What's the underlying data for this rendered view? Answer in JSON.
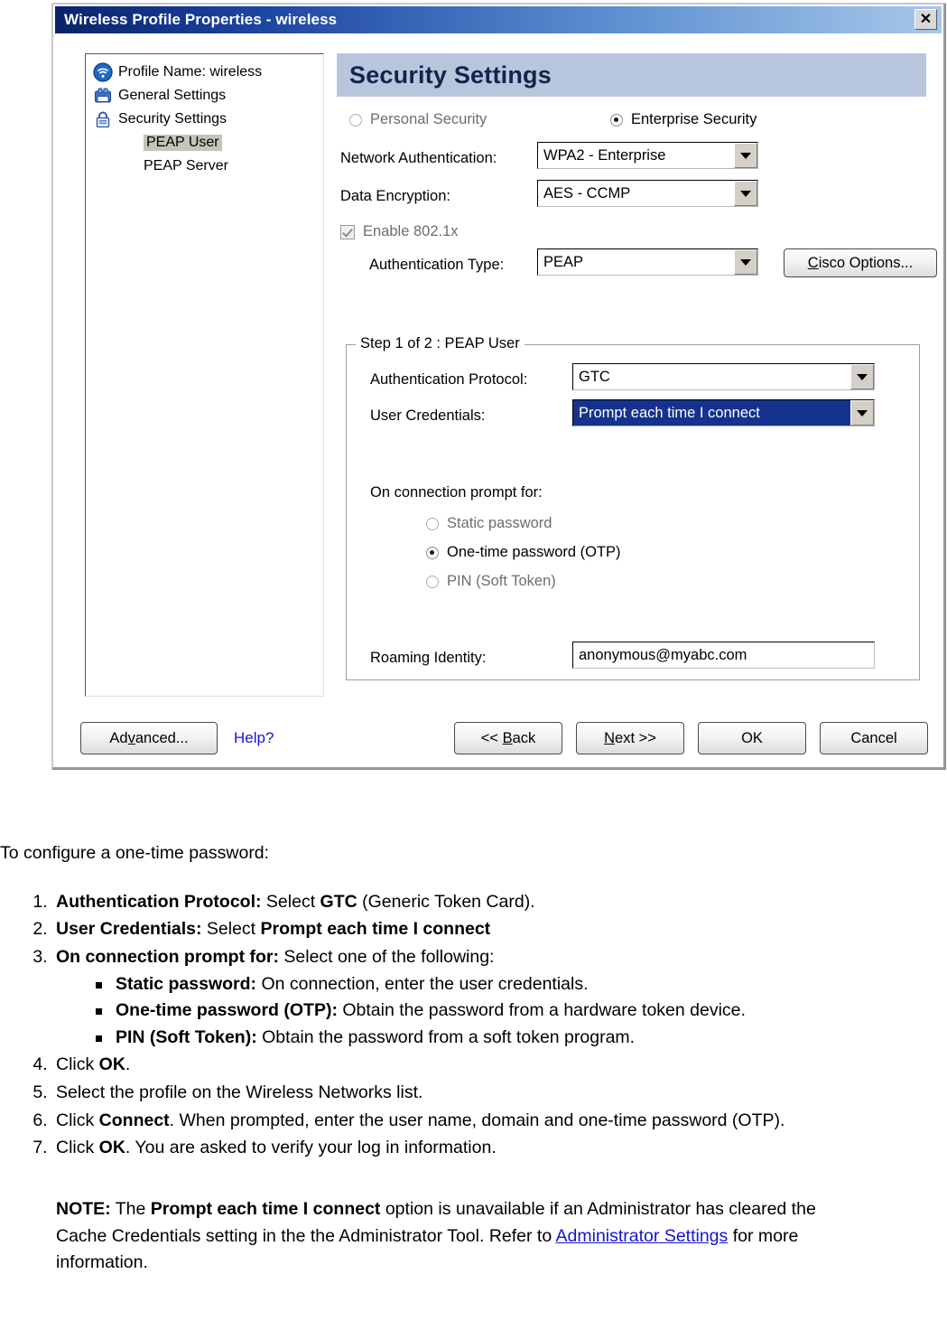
{
  "dialog": {
    "title": "Wireless Profile Properties - wireless",
    "close_label": "✕",
    "pane_title": "Security Settings",
    "tree": {
      "items": [
        {
          "label": "Profile Name: wireless",
          "icon": "wireless-globe-icon",
          "level": 0,
          "selected": false
        },
        {
          "label": "General Settings",
          "icon": "floppy-disk-icon",
          "level": 0,
          "selected": false
        },
        {
          "label": "Security Settings",
          "icon": "padlock-icon",
          "level": 0,
          "selected": false
        },
        {
          "label": "PEAP User",
          "icon": "",
          "level": 1,
          "selected": true
        },
        {
          "label": "PEAP Server",
          "icon": "",
          "level": 1,
          "selected": false
        }
      ]
    },
    "security_mode": {
      "personal_label": "Personal Security",
      "personal_selected": false,
      "enterprise_label": "Enterprise Security",
      "enterprise_selected": true
    },
    "fields": {
      "network_auth_label": "Network Authentication:",
      "network_auth_value": "WPA2 - Enterprise",
      "data_encryption_label": "Data Encryption:",
      "data_encryption_value": "AES - CCMP",
      "enable_8021x_label": "Enable 802.1x",
      "enable_8021x_checked": true,
      "enable_8021x_disabled": true,
      "auth_type_label": "Authentication Type:",
      "auth_type_value": "PEAP",
      "cisco_options_label": "Cisco Options..."
    },
    "step_group": {
      "title": "Step 1 of 2 : PEAP User",
      "auth_protocol_label": "Authentication Protocol:",
      "auth_protocol_value": "GTC",
      "user_credentials_label": "User Credentials:",
      "user_credentials_value": "Prompt each time I connect",
      "prompt_for_label": "On connection prompt for:",
      "prompt_options": [
        {
          "label": "Static password",
          "selected": false
        },
        {
          "label": "One-time password (OTP)",
          "selected": true
        },
        {
          "label": "PIN (Soft Token)",
          "selected": false
        }
      ],
      "roaming_identity_label": "Roaming Identity:",
      "roaming_identity_value": "anonymous@myabc.com"
    },
    "footer": {
      "advanced_label": "Advanced...",
      "advanced_mnemonic": "v",
      "help_label": "Help?",
      "back_label": "<< Back",
      "back_mnemonic": "B",
      "next_label": "Next >>",
      "next_mnemonic": "N",
      "ok_label": "OK",
      "cancel_label": "Cancel"
    },
    "colors": {
      "titlebar_start": "#0a246a",
      "titlebar_end": "#a8c8ea",
      "pane_header_bg": "#b7c6dd",
      "pane_header_text": "#10254a",
      "combo_selected_bg": "#15328c",
      "link": "#1414cf",
      "tree_selection_bg": "#c6c3bc"
    }
  },
  "doc": {
    "intro": "To configure a one-time password:",
    "steps": [
      {
        "bold": "Authentication Protocol:",
        "text": " Select ",
        "bold2": "GTC",
        "tail": " (Generic Token Card)."
      },
      {
        "bold": "User Credentials:",
        "text": " Select ",
        "bold2": "Prompt each time I connect",
        "tail": ""
      },
      {
        "bold": "On connection prompt for:",
        "text": " Select one of the following:",
        "bold2": "",
        "tail": ""
      }
    ],
    "substeps": [
      {
        "bold": "Static password:",
        "text": " On connection, enter the user credentials."
      },
      {
        "bold": "One-time password (OTP):",
        "text": " Obtain the password from a hardware token device."
      },
      {
        "bold": "PIN (Soft Token):",
        "text": " Obtain the password from a soft token program."
      }
    ],
    "steps_after": [
      {
        "pre": "Click ",
        "bold": "OK",
        "tail": "."
      },
      {
        "pre": "Select the profile on the Wireless Networks list.",
        "bold": "",
        "tail": ""
      },
      {
        "pre": "Click ",
        "bold": "Connect",
        "tail": ". When prompted, enter the user name, domain and one-time password (OTP)."
      },
      {
        "pre": "Click ",
        "bold": "OK",
        "tail": ". You are asked to verify your log in information."
      }
    ],
    "note": {
      "label": "NOTE:",
      "text1": " The ",
      "bold1": "Prompt each time I connect",
      "text2": " option is unavailable if an Administrator has cleared the Cache Credentials setting in the the Administrator Tool. Refer to ",
      "link": "Administrator Settings",
      "text3": " for more information."
    }
  }
}
